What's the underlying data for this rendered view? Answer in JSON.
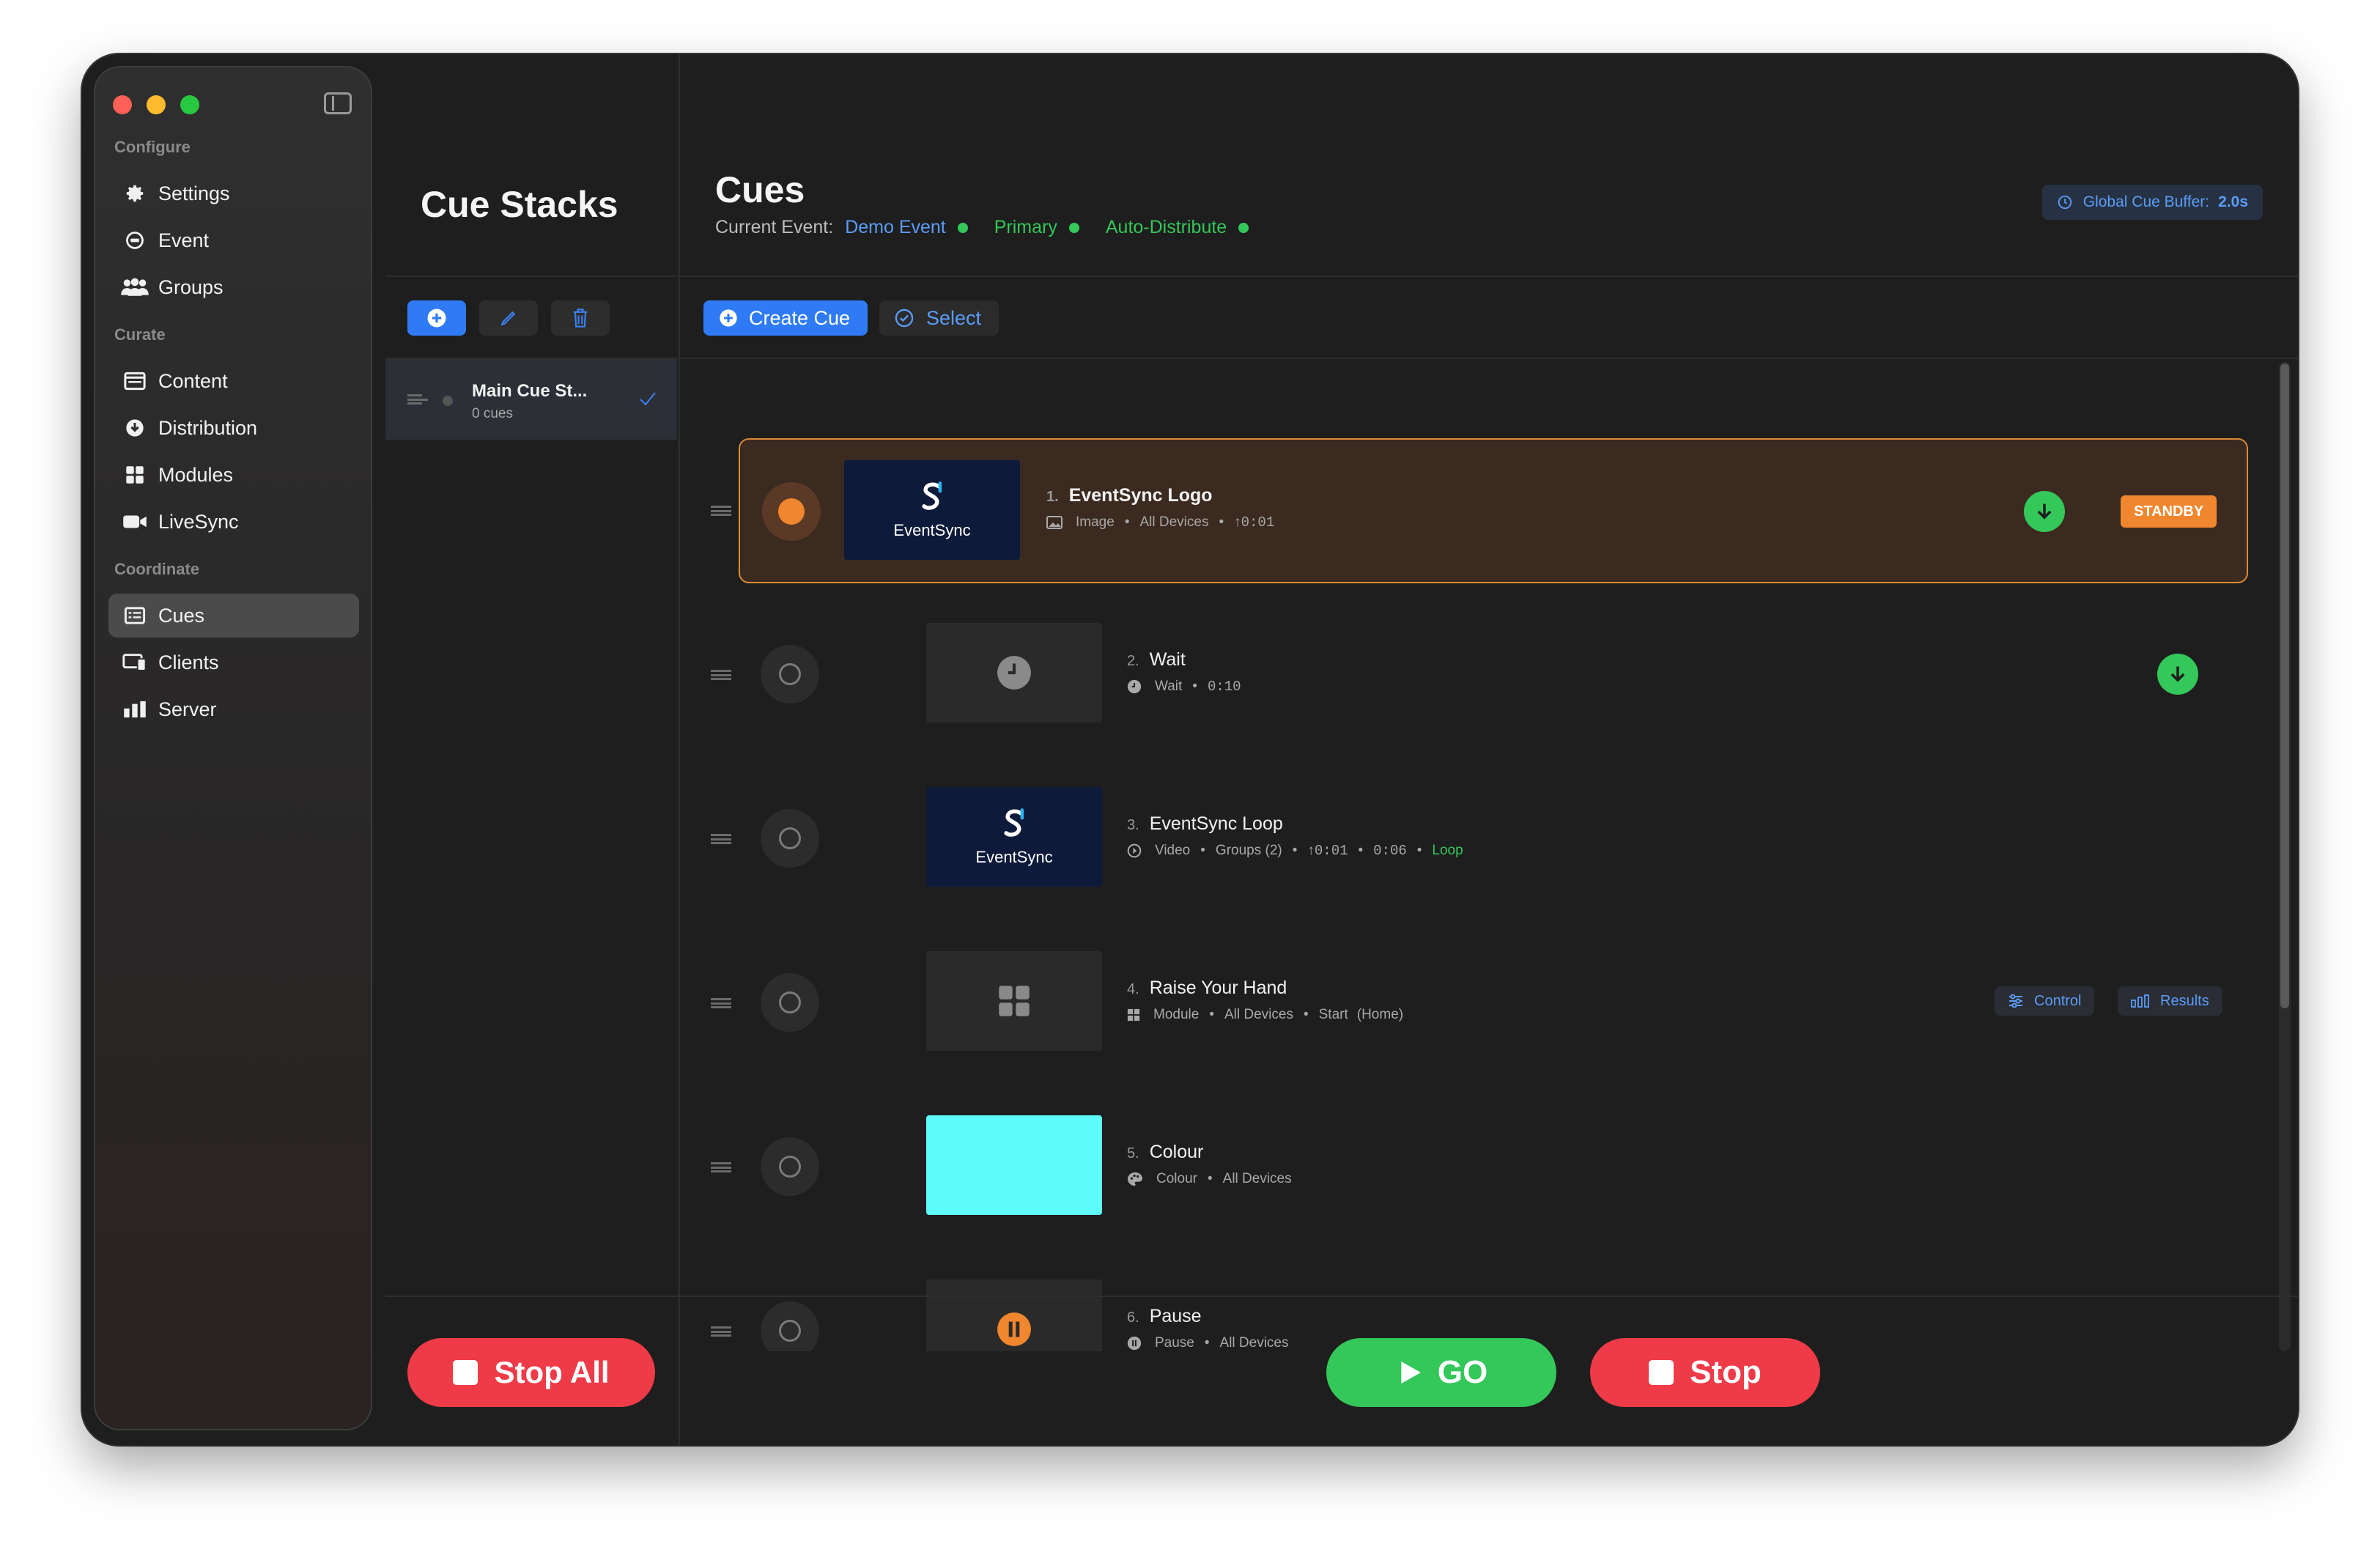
{
  "sidebar": {
    "sections": [
      {
        "title": "Configure",
        "items": [
          {
            "label": "Settings",
            "icon": "gear-icon"
          },
          {
            "label": "Event",
            "icon": "event-icon"
          },
          {
            "label": "Groups",
            "icon": "groups-icon"
          }
        ]
      },
      {
        "title": "Curate",
        "items": [
          {
            "label": "Content",
            "icon": "content-icon"
          },
          {
            "label": "Distribution",
            "icon": "distribution-icon"
          },
          {
            "label": "Modules",
            "icon": "modules-icon"
          },
          {
            "label": "LiveSync",
            "icon": "video-icon"
          }
        ]
      },
      {
        "title": "Coordinate",
        "items": [
          {
            "label": "Cues",
            "icon": "cues-icon"
          },
          {
            "label": "Clients",
            "icon": "clients-icon"
          },
          {
            "label": "Server",
            "icon": "server-icon"
          }
        ]
      }
    ],
    "active": "Cues"
  },
  "stacks": {
    "title": "Cue Stacks",
    "items": [
      {
        "name": "Main Cue St...",
        "count": "0 cues"
      }
    ],
    "stop_all_label": "Stop All"
  },
  "header": {
    "title": "Cues",
    "current_event_label": "Current Event:",
    "event_name": "Demo Event",
    "server_role": "Primary",
    "distribution_mode": "Auto-Distribute",
    "buffer_label": "Global Cue Buffer:",
    "buffer_value": "2.0s"
  },
  "toolbar": {
    "create_label": "Create Cue",
    "select_label": "Select"
  },
  "cues": [
    {
      "num": "1.",
      "name": "EventSync Logo",
      "type": "Image",
      "target": "All Devices",
      "fade": "0:01",
      "status": "STANDBY"
    },
    {
      "num": "2.",
      "name": "Wait",
      "type": "Wait",
      "duration": "0:10"
    },
    {
      "num": "3.",
      "name": "EventSync Loop",
      "type": "Video",
      "target": "Groups (2)",
      "fade": "0:01",
      "duration": "0:06",
      "loop": "Loop"
    },
    {
      "num": "4.",
      "name": "Raise Your Hand",
      "type": "Module",
      "target": "All Devices",
      "action": "Start",
      "action_detail": "(Home)",
      "control_label": "Control",
      "results_label": "Results"
    },
    {
      "num": "5.",
      "name": "Colour",
      "type": "Colour",
      "target": "All Devices",
      "color": "#5ffbfb"
    },
    {
      "num": "6.",
      "name": "Pause",
      "type": "Pause",
      "target": "All Devices"
    }
  ],
  "logo_text": "EventSync",
  "transport": {
    "go_label": "GO",
    "stop_label": "Stop"
  },
  "colors": {
    "accent": "#2f7bf5",
    "go": "#34c759",
    "stop": "#ef3b48",
    "standby": "#f0862e"
  }
}
